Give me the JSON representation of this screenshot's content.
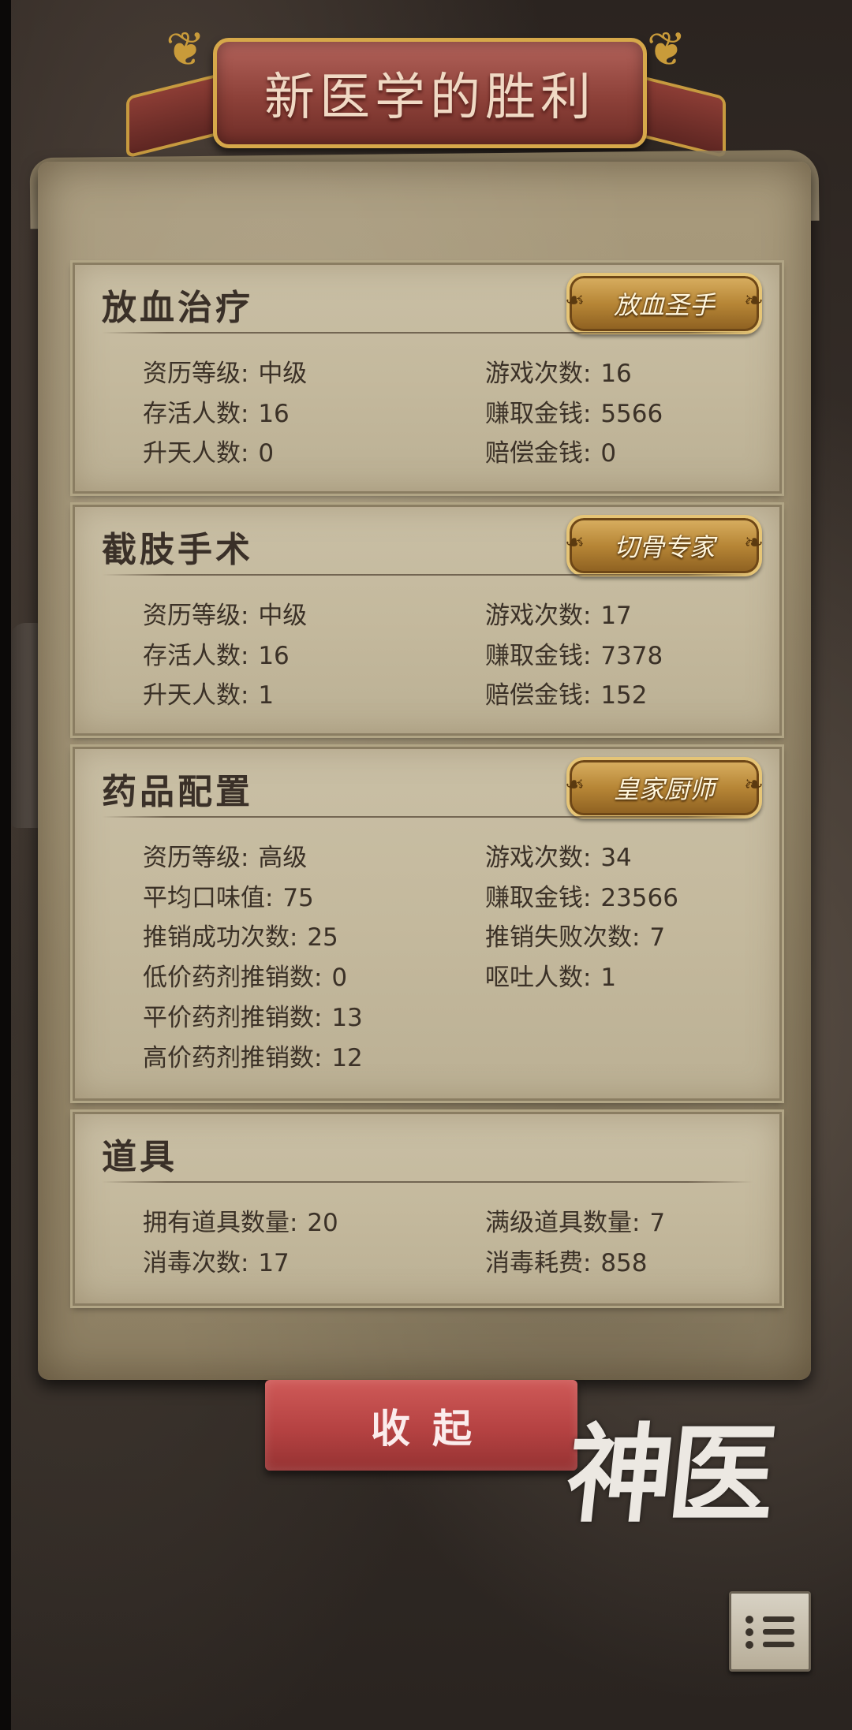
{
  "title": "新医学的胜利",
  "sections": [
    {
      "title": "放血治疗",
      "badge": "放血圣手",
      "stats": [
        {
          "label": "资历等级",
          "value": "中级"
        },
        {
          "label": "游戏次数",
          "value": "16"
        },
        {
          "label": "存活人数",
          "value": "16"
        },
        {
          "label": "赚取金钱",
          "value": "5566"
        },
        {
          "label": "升天人数",
          "value": "0"
        },
        {
          "label": "赔偿金钱",
          "value": "0"
        }
      ]
    },
    {
      "title": "截肢手术",
      "badge": "切骨专家",
      "stats": [
        {
          "label": "资历等级",
          "value": "中级"
        },
        {
          "label": "游戏次数",
          "value": "17"
        },
        {
          "label": "存活人数",
          "value": "16"
        },
        {
          "label": "赚取金钱",
          "value": "7378"
        },
        {
          "label": "升天人数",
          "value": "1"
        },
        {
          "label": "赔偿金钱",
          "value": "152"
        }
      ]
    },
    {
      "title": "药品配置",
      "badge": "皇家厨师",
      "stats": [
        {
          "label": "资历等级",
          "value": "高级"
        },
        {
          "label": "游戏次数",
          "value": "34"
        },
        {
          "label": "平均口味值",
          "value": "75"
        },
        {
          "label": "赚取金钱",
          "value": "23566"
        },
        {
          "label": "推销成功次数",
          "value": "25"
        },
        {
          "label": "推销失败次数",
          "value": "7"
        },
        {
          "label": "低价药剂推销数",
          "value": "0"
        },
        {
          "label": "呕吐人数",
          "value": "1"
        },
        {
          "label": "平价药剂推销数",
          "value": "13"
        },
        {
          "label": "高价药剂推销数",
          "value": "12"
        }
      ]
    },
    {
      "title": "道具",
      "stats": [
        {
          "label": "拥有道具数量",
          "value": "20"
        },
        {
          "label": "满级道具数量",
          "value": "7"
        },
        {
          "label": "消毒次数",
          "value": "17"
        },
        {
          "label": "消毒耗费",
          "value": "858"
        }
      ]
    }
  ],
  "collapse_label": "收起",
  "logo_text": "神医",
  "menu_icon": "list-icon",
  "colors": {
    "banner": "#8d4139",
    "button": "#b54242",
    "badge": "#b78636",
    "parchment": "#c4b99d"
  }
}
